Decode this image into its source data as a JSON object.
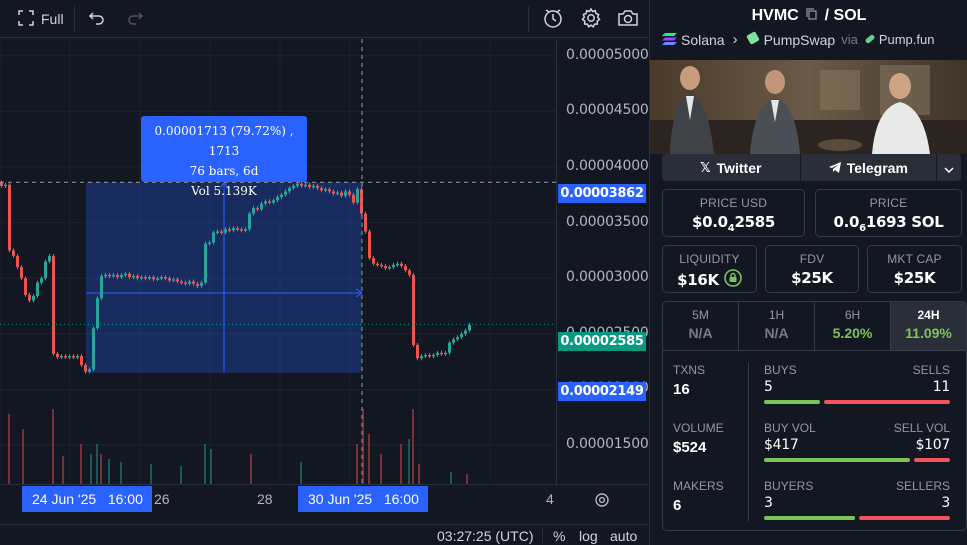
{
  "toolbar": {
    "full_label": "Full",
    "icons": [
      "fullscreen-icon",
      "undo-icon",
      "redo-icon",
      "replay-icon",
      "settings-icon",
      "camera-icon"
    ]
  },
  "chart_data": {
    "type": "candlestick",
    "y_ticks": [
      "0.00005000",
      "0.00004500",
      "0.00004000",
      "0.00003500",
      "0.00003000",
      "0.00002500",
      "0.00002000",
      "0.00001500"
    ],
    "x_labels": [
      "26",
      "28",
      "4"
    ],
    "measure_tooltip": {
      "line1": "0.00001713 (79.72%) , 1713",
      "line2": "76 bars, 6d",
      "line3": "Vol 5.139K"
    },
    "price_tags": {
      "crosshair": "0.00003862",
      "last_price": "0.00002585",
      "range_low": "0.00002149"
    },
    "time_tags": {
      "range_start": "24 Jun '25   16:00",
      "range_end": "30 Jun '25   16:00"
    },
    "colors": {
      "up": "#26a69a",
      "down": "#ef5350",
      "range": "#2962ff",
      "last_price": "#089981"
    },
    "scale": {
      "y_min": 1.15e-05,
      "y_max": 5.15e-05
    }
  },
  "status_bar": {
    "time": "03:27:25 (UTC)",
    "percent_label": "%",
    "log_label": "log",
    "auto_label": "auto"
  },
  "token": {
    "symbol": "HVMC",
    "separator": "/",
    "quote": "SOL",
    "chain": "Solana",
    "dex": "PumpSwap",
    "via": "via",
    "launchpad": "Pump.fun"
  },
  "social": {
    "twitter": "Twitter",
    "telegram": "Telegram"
  },
  "price_usd": {
    "label": "PRICE USD",
    "prefix": "$0.0",
    "zeros": "4",
    "digits": "2585"
  },
  "price_native": {
    "label": "PRICE",
    "prefix": "0.0",
    "zeros": "6",
    "digits": "1693 SOL"
  },
  "liquidity": {
    "label": "LIQUIDITY",
    "value": "$16K"
  },
  "fdv": {
    "label": "FDV",
    "value": "$25K"
  },
  "mkt_cap": {
    "label": "MKT CAP",
    "value": "$25K"
  },
  "timeframes": [
    {
      "label": "5M",
      "value": "N/A",
      "color": "#787b86"
    },
    {
      "label": "1H",
      "value": "N/A",
      "color": "#787b86"
    },
    {
      "label": "6H",
      "value": "5.20%",
      "color": "#7cc35a"
    },
    {
      "label": "24H",
      "value": "11.09%",
      "color": "#7cc35a"
    }
  ],
  "txns": {
    "label": "TXNS",
    "value": "16",
    "buys_label": "BUYS",
    "buys": "5",
    "sells_label": "SELLS",
    "sells": "11",
    "buy_share": 0.31
  },
  "volume": {
    "label": "VOLUME",
    "value": "$524",
    "buy_label": "BUY VOL",
    "buy": "$417",
    "sell_label": "SELL VOL",
    "sell": "$107",
    "buy_share": 0.8
  },
  "makers": {
    "label": "MAKERS",
    "value": "6",
    "buyers_label": "BUYERS",
    "buyers": "3",
    "sellers_label": "SELLERS",
    "sellers": "3",
    "buy_share": 0.5
  }
}
